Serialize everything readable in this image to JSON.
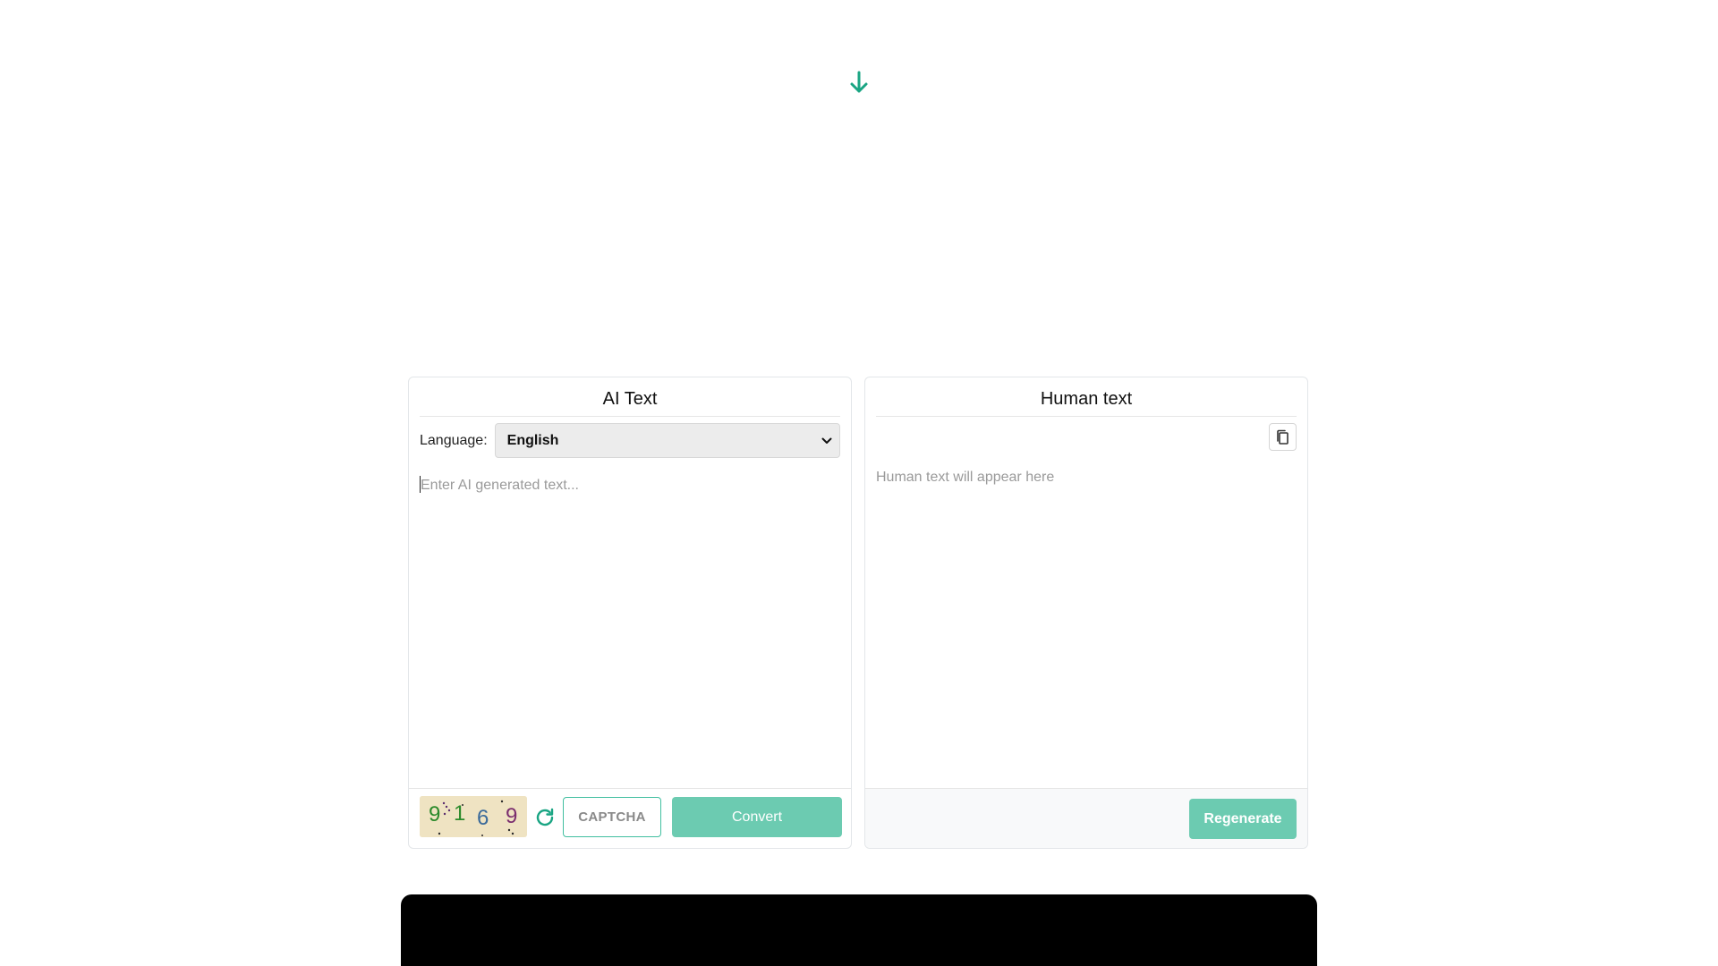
{
  "colors": {
    "accent": "#1aa583",
    "button": "#6ccbb1",
    "captcha_border": "#41bfa0",
    "captcha_bg": "#efe3c2"
  },
  "icons": {
    "down_arrow": "arrow-down-icon",
    "refresh": "refresh-icon",
    "copy": "copy-icon",
    "select_chevron": "chevron-down-icon"
  },
  "ai_panel": {
    "title": "AI Text",
    "language_label": "Language:",
    "language_value": "English",
    "input_placeholder": "Enter AI generated text...",
    "input_value": "",
    "captcha_digits": [
      "9",
      "1",
      "6",
      "9"
    ],
    "captcha_placeholder": "CAPTCHA",
    "convert_label": "Convert"
  },
  "human_panel": {
    "title": "Human text",
    "output_placeholder": "Human text will appear here",
    "regenerate_label": "Regenerate"
  }
}
